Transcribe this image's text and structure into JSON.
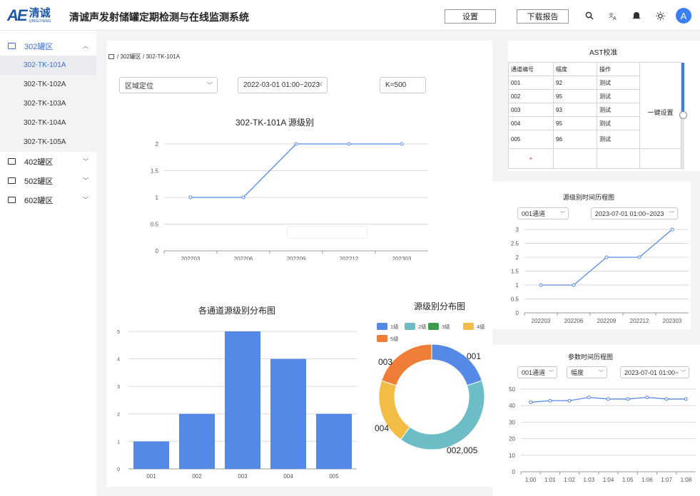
{
  "header": {
    "logo_text": "AE",
    "logo_cn": "清诚",
    "logo_small": "QINGCHENG",
    "title": "清诚声发射储罐定期检测与在线监测系统",
    "settings_label": "设置",
    "download_label": "下载报告",
    "avatar_letter": "A"
  },
  "sidebar": {
    "groups": [
      {
        "label": "302罐区",
        "items": [
          "302-TK-101A",
          "302-TK-102A",
          "302-TK-103A",
          "302-TK-104A",
          "302-TK-105A"
        ]
      },
      {
        "label": "402罐区"
      },
      {
        "label": "502罐区"
      },
      {
        "label": "602罐区"
      }
    ]
  },
  "breadcrumb": "/ 302罐区 / 302-TK-101A",
  "filters": {
    "mode": "区域定位",
    "daterange": "2022-03-01 01:00~2023-",
    "k_value": "K=500"
  },
  "line_chart": {
    "title": "302-TK-101A 源级别",
    "categories": [
      "202203",
      "202206",
      "202209",
      "202212",
      "202303"
    ],
    "values": [
      1,
      1,
      2,
      2,
      2
    ],
    "yticks": [
      "0",
      "0.5",
      "1",
      "1.5",
      "2"
    ],
    "ylim": [
      0,
      2
    ]
  },
  "bar_chart": {
    "title": "各通道源级别分布图",
    "categories": [
      "001",
      "002",
      "003",
      "004",
      "005"
    ],
    "values": [
      1,
      2,
      5,
      4,
      2
    ],
    "yticks": [
      "0",
      "1",
      "2",
      "3",
      "4",
      "5"
    ],
    "color": "#5589e8"
  },
  "donut": {
    "title": "源级别分布图",
    "legend": [
      "1级",
      "2级",
      "3级",
      "4级",
      "5级"
    ],
    "colors": [
      "#5589e8",
      "#6cbdc6",
      "#3f9a4c",
      "#f2bc45",
      "#ee7d37"
    ],
    "labels": [
      "001",
      "002,005",
      "004",
      "003"
    ]
  },
  "ast": {
    "title": "AST校准",
    "headers": [
      "通道编号",
      "幅度",
      "操作"
    ],
    "rows": [
      {
        "ch": "001",
        "amp": "92",
        "op": "测试"
      },
      {
        "ch": "002",
        "amp": "95",
        "op": "测试"
      },
      {
        "ch": "003",
        "amp": "93",
        "op": "测试"
      },
      {
        "ch": "004",
        "amp": "95",
        "op": "测试"
      },
      {
        "ch": "005",
        "amp": "96",
        "op": "测试"
      }
    ],
    "add": "+",
    "one_key": "一键设置"
  },
  "hist1": {
    "title": "源级别时间历程图",
    "channel": "001通道",
    "date": "2023-07-01 01:00~2023",
    "categories": [
      "202203",
      "202206",
      "202209",
      "202212",
      "202303"
    ],
    "values": [
      1,
      1,
      2,
      2,
      3
    ],
    "yticks": [
      "0",
      "0.5",
      "1",
      "1.5",
      "2",
      "2.5",
      "3"
    ]
  },
  "hist2": {
    "title": "参数时间历程图",
    "channel": "001通道",
    "param": "幅度",
    "date": "2023-07-01 01:00~",
    "categories": [
      "1:00",
      "1:01",
      "1:02",
      "1:03",
      "1:04",
      "1:05",
      "1:06",
      "1:07",
      "1:08"
    ],
    "values": [
      42,
      43,
      43,
      45,
      44,
      44,
      45,
      44,
      44
    ],
    "yticks": [
      "0",
      "10",
      "20",
      "30",
      "40",
      "50"
    ]
  },
  "chart_data": [
    {
      "type": "line",
      "title": "302-TK-101A 源级别",
      "x": [
        "202203",
        "202206",
        "202209",
        "202212",
        "202303"
      ],
      "values": [
        1,
        1,
        2,
        2,
        2
      ],
      "ylim": [
        0,
        2
      ]
    },
    {
      "type": "bar",
      "title": "各通道源级别分布图",
      "categories": [
        "001",
        "002",
        "003",
        "004",
        "005"
      ],
      "values": [
        1,
        2,
        5,
        4,
        2
      ],
      "ylim": [
        0,
        5
      ]
    },
    {
      "type": "pie",
      "title": "源级别分布图",
      "categories": [
        "1级",
        "2级",
        "3级",
        "4级",
        "5级"
      ],
      "labels": [
        "001",
        "002,005",
        "004",
        "003"
      ],
      "values": [
        1,
        2,
        0,
        1,
        1
      ]
    },
    {
      "type": "line",
      "title": "源级别时间历程图",
      "x": [
        "202203",
        "202206",
        "202209",
        "202212",
        "202303"
      ],
      "values": [
        1,
        1,
        2,
        2,
        3
      ],
      "ylim": [
        0,
        3
      ]
    },
    {
      "type": "line",
      "title": "参数时间历程图",
      "x": [
        "1:00",
        "1:01",
        "1:02",
        "1:03",
        "1:04",
        "1:05",
        "1:06",
        "1:07",
        "1:08"
      ],
      "values": [
        42,
        43,
        43,
        45,
        44,
        44,
        45,
        44,
        44
      ],
      "ylim": [
        0,
        50
      ]
    }
  ]
}
